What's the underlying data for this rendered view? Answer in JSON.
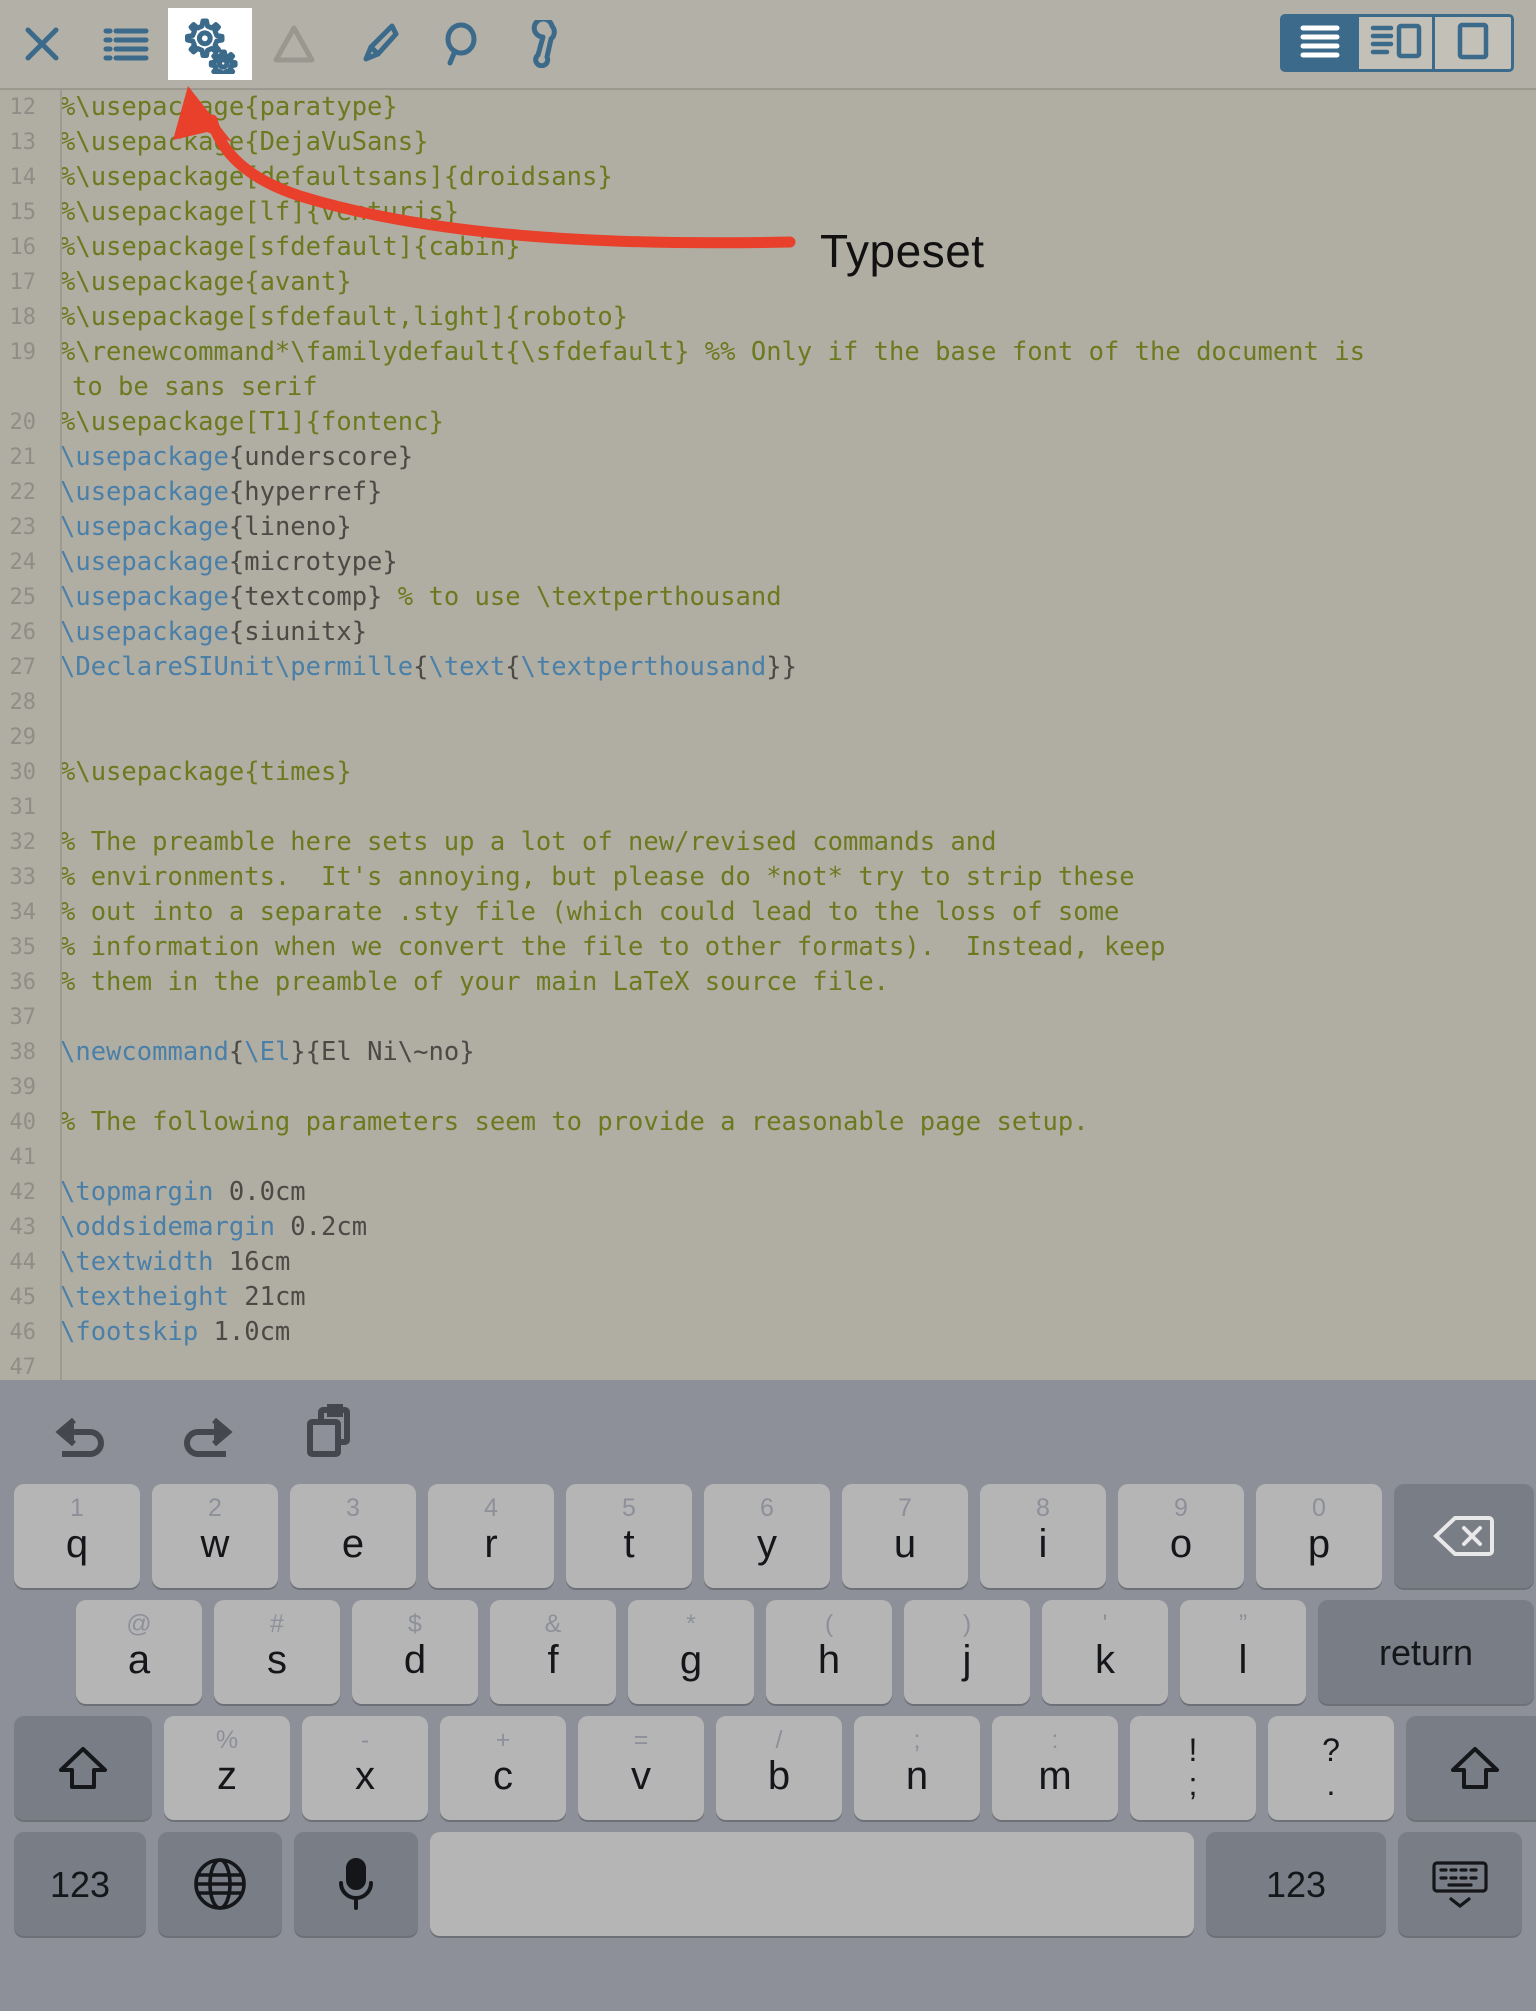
{
  "toolbar": {
    "left_buttons": [
      {
        "name": "close-icon",
        "label": "Close"
      },
      {
        "name": "list-icon",
        "label": "Navigate"
      },
      {
        "name": "gears-icon",
        "label": "Typeset"
      },
      {
        "name": "warning-icon",
        "label": "Errors"
      },
      {
        "name": "brush-icon",
        "label": "Clean"
      },
      {
        "name": "search-icon",
        "label": "Search"
      },
      {
        "name": "wrench-icon",
        "label": "Settings"
      }
    ],
    "layout_segments": [
      {
        "name": "editor-only-layout",
        "selected": true
      },
      {
        "name": "split-layout",
        "selected": false
      },
      {
        "name": "preview-only-layout",
        "selected": false
      }
    ],
    "accent_color": "#3b6a8a",
    "active_button_bg": "#ffffff",
    "background_color": "#b3b0a8"
  },
  "annotation": {
    "label": "Typeset",
    "color": "#e8402a",
    "points_to": "gears-icon"
  },
  "editor": {
    "background_color": "#b0ada3",
    "comment_color": "#6b7a1e",
    "command_color": "#4a7fa8",
    "plain_color": "#4c4a45",
    "linenumber_color": "#8f8d86",
    "lines": [
      {
        "n": "12",
        "segs": [
          {
            "t": "%\\usepackage{paratype}",
            "c": "comment"
          }
        ]
      },
      {
        "n": "13",
        "segs": [
          {
            "t": "%\\usepackage{DejaVuSans}",
            "c": "comment"
          }
        ]
      },
      {
        "n": "14",
        "segs": [
          {
            "t": "%\\usepackage[defaultsans]{droidsans}",
            "c": "comment"
          }
        ]
      },
      {
        "n": "15",
        "segs": [
          {
            "t": "%\\usepackage[lf]{venturis}",
            "c": "comment"
          }
        ]
      },
      {
        "n": "16",
        "segs": [
          {
            "t": "%\\usepackage[sfdefault]{cabin}",
            "c": "comment"
          }
        ]
      },
      {
        "n": "17",
        "segs": [
          {
            "t": "%\\usepackage{avant}",
            "c": "comment"
          }
        ]
      },
      {
        "n": "18",
        "segs": [
          {
            "t": "%\\usepackage[sfdefault,light]{roboto}",
            "c": "comment"
          }
        ]
      },
      {
        "n": "19",
        "segs": [
          {
            "t": "%\\renewcommand*\\familydefault{\\sfdefault} %% Only if the base font of the document is",
            "c": "comment"
          }
        ],
        "wrap": "to be sans serif"
      },
      {
        "n": "20",
        "segs": [
          {
            "t": "%\\usepackage[T1]{fontenc}",
            "c": "comment"
          }
        ]
      },
      {
        "n": "21",
        "segs": [
          {
            "t": "\\usepackage",
            "c": "cmd"
          },
          {
            "t": "{underscore}",
            "c": "plain"
          }
        ]
      },
      {
        "n": "22",
        "segs": [
          {
            "t": "\\usepackage",
            "c": "cmd"
          },
          {
            "t": "{hyperref}",
            "c": "plain"
          }
        ]
      },
      {
        "n": "23",
        "segs": [
          {
            "t": "\\usepackage",
            "c": "cmd"
          },
          {
            "t": "{lineno}",
            "c": "plain"
          }
        ]
      },
      {
        "n": "24",
        "segs": [
          {
            "t": "\\usepackage",
            "c": "cmd"
          },
          {
            "t": "{microtype}",
            "c": "plain"
          }
        ]
      },
      {
        "n": "25",
        "segs": [
          {
            "t": "\\usepackage",
            "c": "cmd"
          },
          {
            "t": "{textcomp} ",
            "c": "plain"
          },
          {
            "t": "% to use \\textperthousand",
            "c": "comment"
          }
        ]
      },
      {
        "n": "26",
        "segs": [
          {
            "t": "\\usepackage",
            "c": "cmd"
          },
          {
            "t": "{siunitx}",
            "c": "plain"
          }
        ]
      },
      {
        "n": "27",
        "segs": [
          {
            "t": "\\DeclareSIUnit\\permille",
            "c": "cmd"
          },
          {
            "t": "{",
            "c": "plain"
          },
          {
            "t": "\\text",
            "c": "cmd"
          },
          {
            "t": "{",
            "c": "plain"
          },
          {
            "t": "\\textperthousand",
            "c": "cmd"
          },
          {
            "t": "}}",
            "c": "plain"
          }
        ]
      },
      {
        "n": "28",
        "segs": []
      },
      {
        "n": "29",
        "segs": []
      },
      {
        "n": "30",
        "segs": [
          {
            "t": "%\\usepackage{times}",
            "c": "comment"
          }
        ]
      },
      {
        "n": "31",
        "segs": []
      },
      {
        "n": "32",
        "segs": [
          {
            "t": "% The preamble here sets up a lot of new/revised commands and",
            "c": "comment"
          }
        ]
      },
      {
        "n": "33",
        "segs": [
          {
            "t": "% environments.  It's annoying, but please do *not* try to strip these",
            "c": "comment"
          }
        ]
      },
      {
        "n": "34",
        "segs": [
          {
            "t": "% out into a separate .sty file (which could lead to the loss of some",
            "c": "comment"
          }
        ]
      },
      {
        "n": "35",
        "segs": [
          {
            "t": "% information when we convert the file to other formats).  Instead, keep",
            "c": "comment"
          }
        ]
      },
      {
        "n": "36",
        "segs": [
          {
            "t": "% them in the preamble of your main LaTeX source file.",
            "c": "comment"
          }
        ]
      },
      {
        "n": "37",
        "segs": []
      },
      {
        "n": "38",
        "segs": [
          {
            "t": "\\newcommand",
            "c": "cmd"
          },
          {
            "t": "{",
            "c": "plain"
          },
          {
            "t": "\\El",
            "c": "cmd"
          },
          {
            "t": "}{El Ni\\~no}",
            "c": "plain"
          }
        ]
      },
      {
        "n": "39",
        "segs": []
      },
      {
        "n": "40",
        "segs": [
          {
            "t": "% The following parameters seem to provide a reasonable page setup.",
            "c": "comment"
          }
        ]
      },
      {
        "n": "41",
        "segs": []
      },
      {
        "n": "42",
        "segs": [
          {
            "t": "\\topmargin",
            "c": "cmd"
          },
          {
            "t": " 0.0cm",
            "c": "plain"
          }
        ]
      },
      {
        "n": "43",
        "segs": [
          {
            "t": "\\oddsidemargin",
            "c": "cmd"
          },
          {
            "t": " 0.2cm",
            "c": "plain"
          }
        ]
      },
      {
        "n": "44",
        "segs": [
          {
            "t": "\\textwidth",
            "c": "cmd"
          },
          {
            "t": " 16cm",
            "c": "plain"
          }
        ]
      },
      {
        "n": "45",
        "segs": [
          {
            "t": "\\textheight",
            "c": "cmd"
          },
          {
            "t": " 21cm",
            "c": "plain"
          }
        ]
      },
      {
        "n": "46",
        "segs": [
          {
            "t": "\\footskip",
            "c": "cmd"
          },
          {
            "t": " 1.0cm",
            "c": "plain"
          }
        ]
      },
      {
        "n": "47",
        "segs": []
      }
    ]
  },
  "keyboard": {
    "background_color": "#8d9099",
    "key_color": "#b5b5b5",
    "dark_key_color": "#787d86",
    "tools": [
      {
        "name": "undo-icon",
        "label": "Undo"
      },
      {
        "name": "redo-icon",
        "label": "Redo"
      },
      {
        "name": "paste-icon",
        "label": "Paste"
      }
    ],
    "row1": [
      {
        "main": "q",
        "alt": "1"
      },
      {
        "main": "w",
        "alt": "2"
      },
      {
        "main": "e",
        "alt": "3"
      },
      {
        "main": "r",
        "alt": "4"
      },
      {
        "main": "t",
        "alt": "5"
      },
      {
        "main": "y",
        "alt": "6"
      },
      {
        "main": "u",
        "alt": "7"
      },
      {
        "main": "i",
        "alt": "8"
      },
      {
        "main": "o",
        "alt": "9"
      },
      {
        "main": "p",
        "alt": "0"
      }
    ],
    "row1_backspace": "backspace-icon",
    "row2": [
      {
        "main": "a",
        "alt": "@"
      },
      {
        "main": "s",
        "alt": "#"
      },
      {
        "main": "d",
        "alt": "$"
      },
      {
        "main": "f",
        "alt": "&"
      },
      {
        "main": "g",
        "alt": "*"
      },
      {
        "main": "h",
        "alt": "("
      },
      {
        "main": "j",
        "alt": ")"
      },
      {
        "main": "k",
        "alt": "'"
      },
      {
        "main": "l",
        "alt": "”"
      }
    ],
    "row2_return": "return",
    "row3_shift_left": "shift-icon",
    "row3": [
      {
        "main": "z",
        "alt": "%"
      },
      {
        "main": "x",
        "alt": "-"
      },
      {
        "main": "c",
        "alt": "+"
      },
      {
        "main": "v",
        "alt": "="
      },
      {
        "main": "b",
        "alt": "/"
      },
      {
        "main": "n",
        "alt": ";"
      },
      {
        "main": "m",
        "alt": ":"
      },
      {
        "upper": "!",
        "lower": ";"
      },
      {
        "upper": "?",
        "lower": "."
      }
    ],
    "row3_shift_right": "shift-icon",
    "row4": {
      "numbers_left": "123",
      "globe": "globe-icon",
      "mic": "microphone-icon",
      "space": "",
      "numbers_right": "123",
      "hide": "hide-keyboard-icon"
    }
  }
}
